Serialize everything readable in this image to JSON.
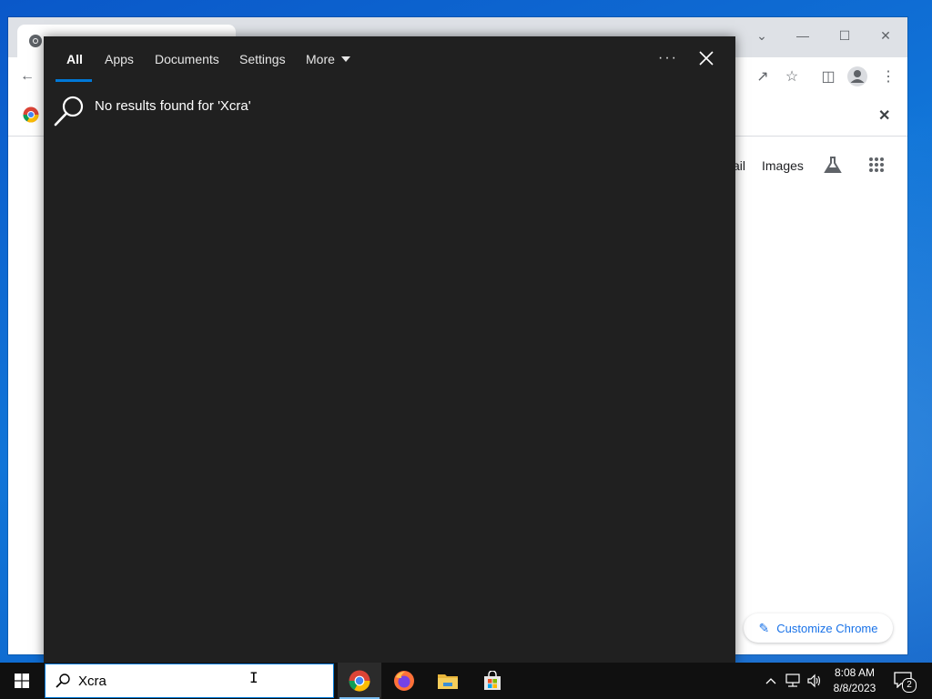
{
  "search_flyout": {
    "tabs": [
      {
        "label": "All",
        "active": true
      },
      {
        "label": "Apps"
      },
      {
        "label": "Documents"
      },
      {
        "label": "Settings"
      },
      {
        "label": "More"
      }
    ],
    "ellipsis": "···",
    "no_results_text": "No results found for 'Xcra'"
  },
  "chrome": {
    "nav_links": [
      "ail",
      "Images"
    ],
    "customize_label": "Customize Chrome"
  },
  "taskbar": {
    "search_value": "Xcra",
    "clock_time": "8:08 AM",
    "clock_date": "8/8/2023",
    "notification_count": "2"
  },
  "colors": {
    "accent": "#0078d7",
    "flyout_bg": "#202020",
    "taskbar_bg": "#101010",
    "chrome_link": "#1a73e8"
  }
}
